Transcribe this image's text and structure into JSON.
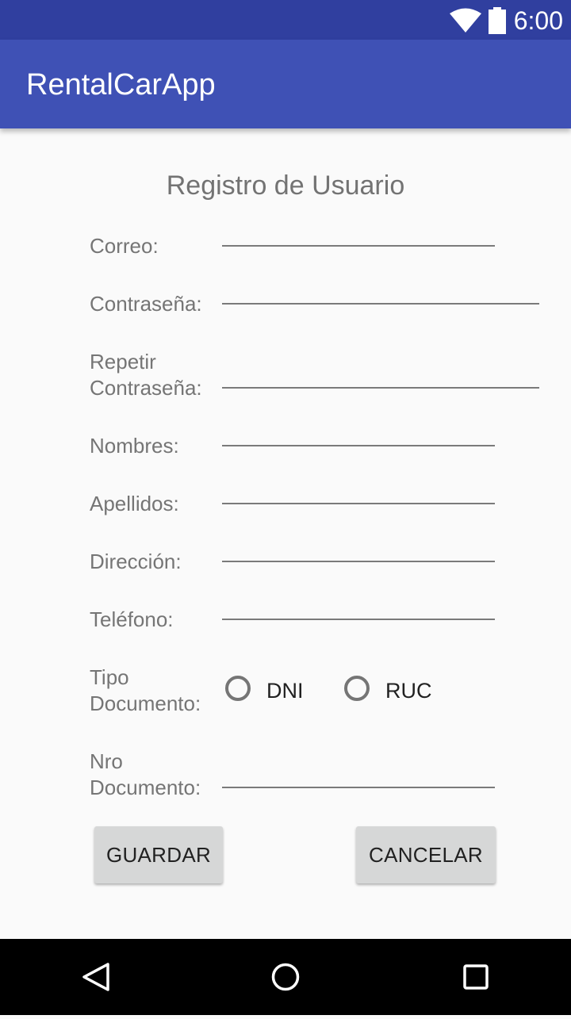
{
  "status_bar": {
    "time": "6:00",
    "icons": [
      "wifi-icon",
      "battery-icon"
    ]
  },
  "app_bar": {
    "title": "RentalCarApp"
  },
  "form": {
    "title": "Registro de Usuario",
    "fields": {
      "correo": {
        "label": "Correo:",
        "value": ""
      },
      "contrasena": {
        "label": "Contraseña:",
        "value": ""
      },
      "repetir_contrasena": {
        "label_line1": "Repetir",
        "label_line2": "Contraseña:",
        "value": ""
      },
      "nombres": {
        "label": "Nombres:",
        "value": ""
      },
      "apellidos": {
        "label": "Apellidos:",
        "value": ""
      },
      "direccion": {
        "label": "Dirección:",
        "value": ""
      },
      "telefono": {
        "label": "Teléfono:",
        "value": ""
      },
      "tipo_documento": {
        "label_line1": "Tipo",
        "label_line2": "Documento:",
        "options": [
          "DNI",
          "RUC"
        ],
        "selected": null
      },
      "nro_documento": {
        "label_line1": "Nro",
        "label_line2": "Documento:",
        "value": ""
      }
    },
    "buttons": {
      "save": "GUARDAR",
      "cancel": "CANCELAR"
    }
  },
  "nav_bar": {
    "icons": [
      "back-icon",
      "home-icon",
      "recents-icon"
    ]
  },
  "colors": {
    "primary": "#3f51b5",
    "primary_dark": "#303f9f",
    "background": "#fafafa",
    "button": "#d6d7d7"
  }
}
